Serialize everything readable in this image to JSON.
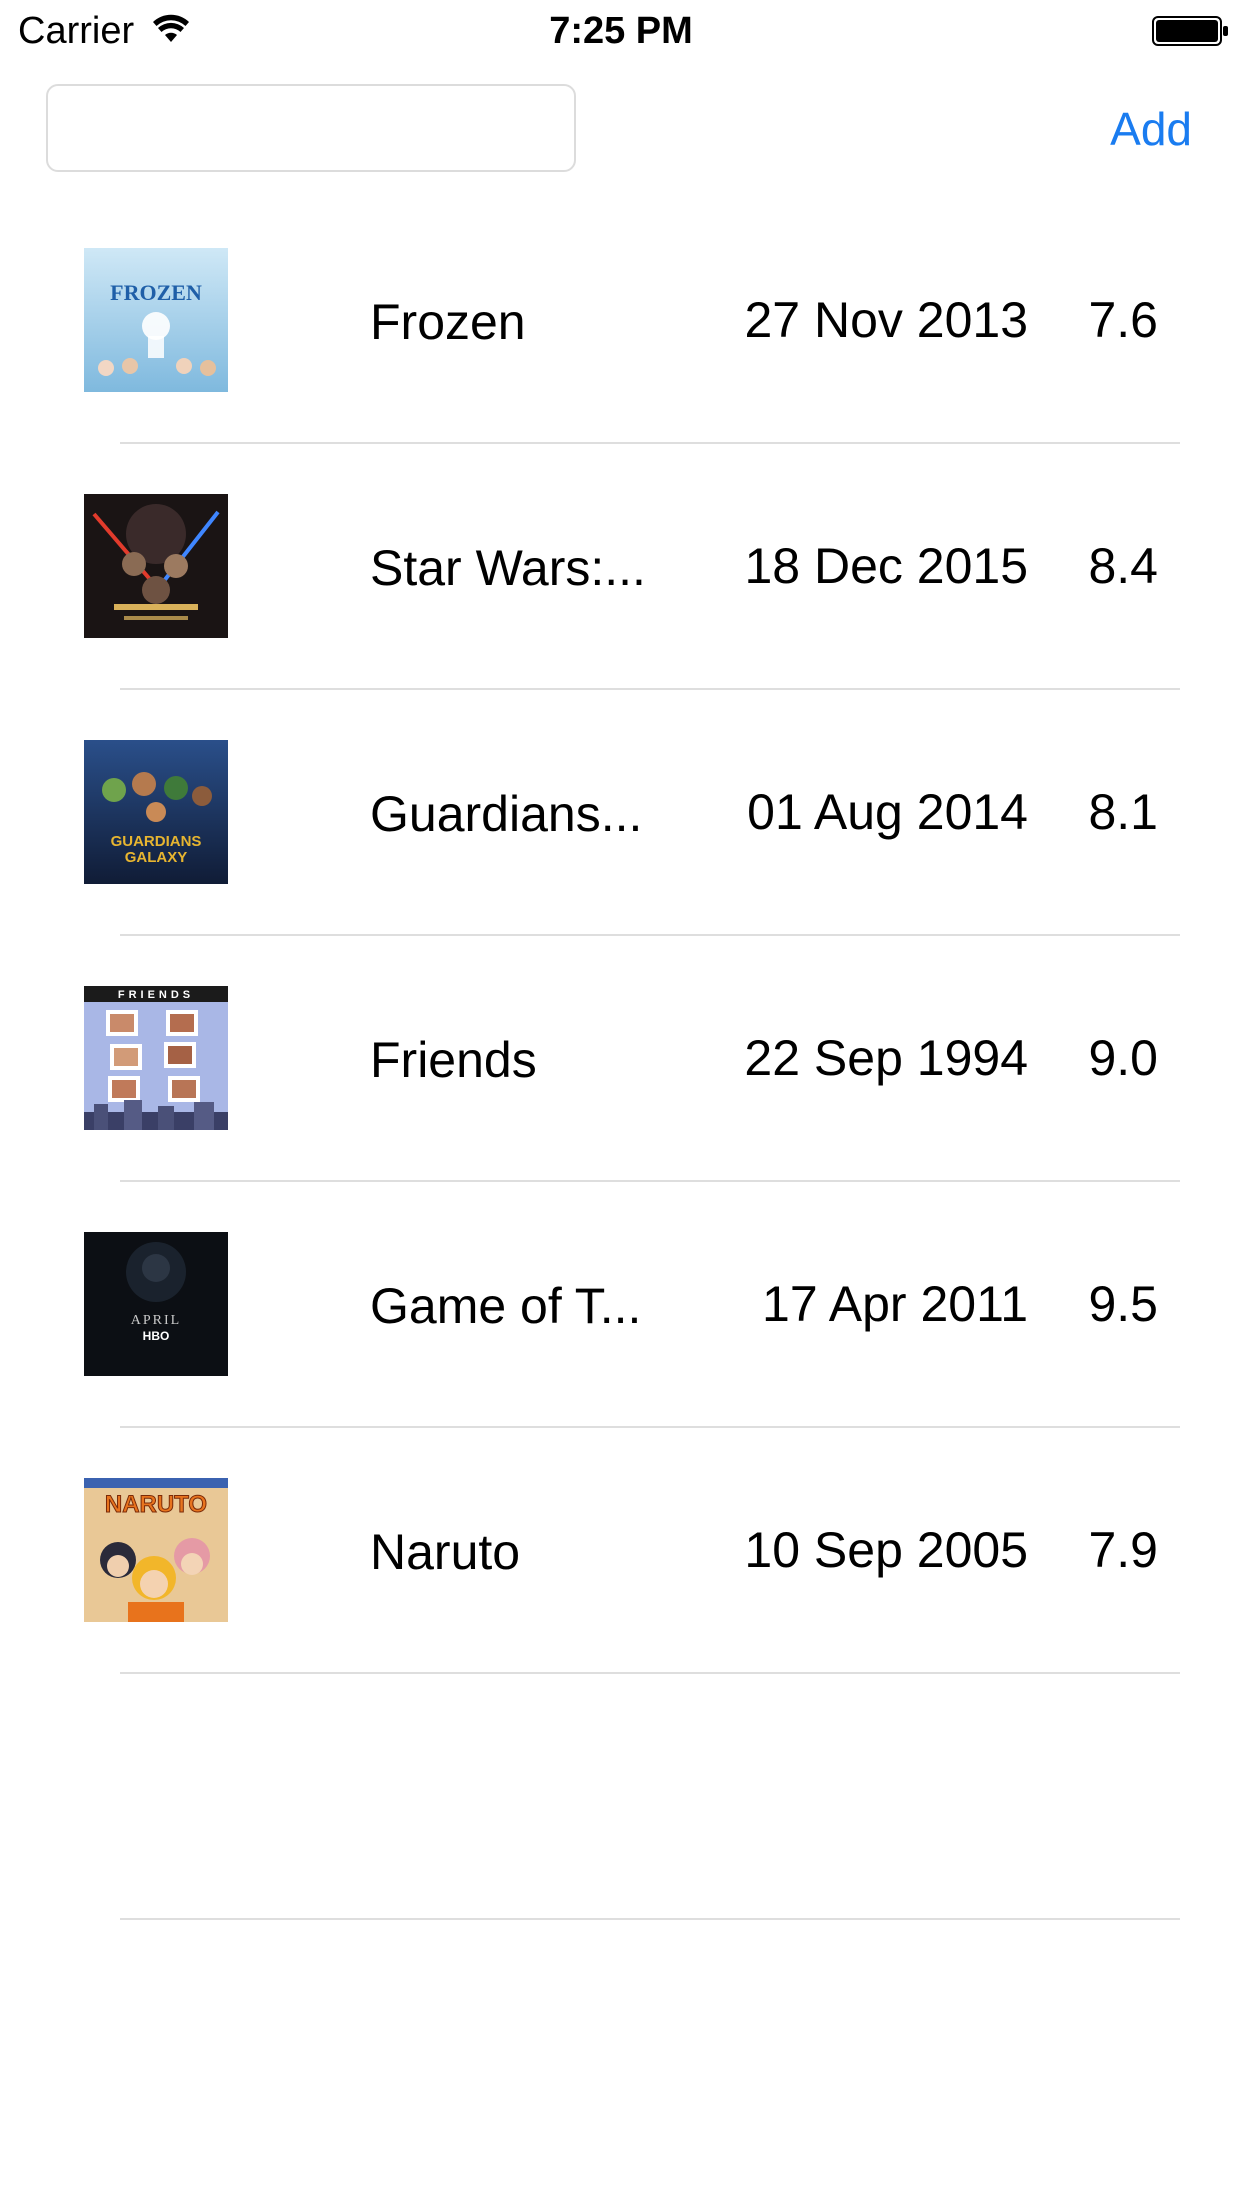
{
  "status_bar": {
    "carrier": "Carrier",
    "time": "7:25 PM",
    "wifi_icon": "wifi-icon",
    "battery_icon": "battery-full-icon"
  },
  "toolbar": {
    "search_value": "",
    "search_placeholder": "",
    "add_label": "Add",
    "accent_color": "#1a7cf0"
  },
  "movies": [
    {
      "title": "Frozen",
      "date": "27 Nov 2013",
      "rating": "7.6",
      "poster": "frozen-poster"
    },
    {
      "title": "Star Wars:...",
      "date": "18 Dec 2015",
      "rating": "8.4",
      "poster": "star-wars-poster"
    },
    {
      "title": "Guardians...",
      "date": "01 Aug 2014",
      "rating": "8.1",
      "poster": "guardians-poster"
    },
    {
      "title": "Friends",
      "date": "22 Sep 1994",
      "rating": "9.0",
      "poster": "friends-poster"
    },
    {
      "title": "Game of T...",
      "date": "17 Apr 2011",
      "rating": "9.5",
      "poster": "game-of-thrones-poster"
    },
    {
      "title": "Naruto",
      "date": "10 Sep 2005",
      "rating": "7.9",
      "poster": "naruto-poster"
    }
  ],
  "posters": {
    "frozen_text": "FROZEN",
    "guardians_text": "GUARDIANS",
    "guardians_text2": "GALAXY",
    "friends_text": "FRIENDS",
    "got_text": "APRIL",
    "got_text2": "HBO",
    "naruto_text": "NARUTO"
  }
}
